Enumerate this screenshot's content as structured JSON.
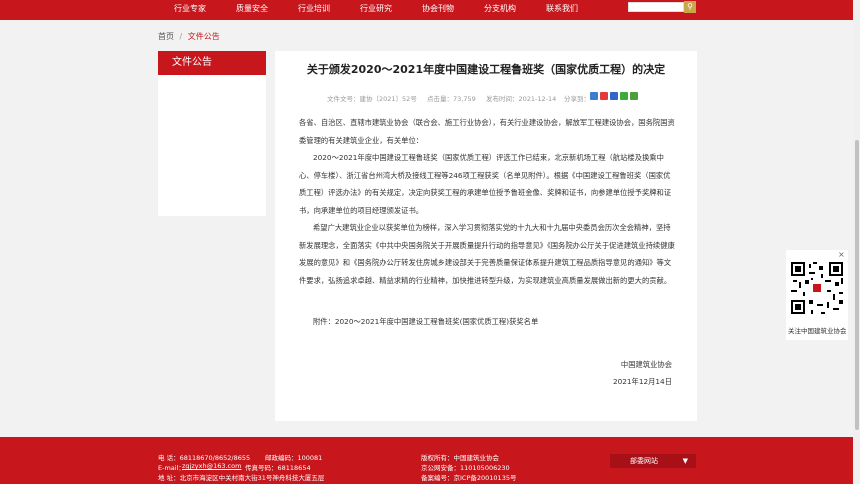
{
  "nav": {
    "items": [
      "行业专家",
      "质量安全",
      "行业培训",
      "行业研究",
      "协会刊物",
      "分支机构",
      "联系我们"
    ],
    "search_icon": "search-icon"
  },
  "breadcrumb": {
    "home": "首页",
    "separator": "/",
    "current": "文件公告"
  },
  "sidebar": {
    "title": "文件公告"
  },
  "article": {
    "title": "关于颁发2020～2021年度中国建设工程鲁班奖（国家优质工程）的决定",
    "meta": {
      "doc_no": "文件文号：建协〔2021〕52号",
      "views": "点击量：73,759",
      "date": "发布时间：2021-12-14",
      "share": "分享到："
    },
    "paragraphs": [
      "各省、自治区、直辖市建筑业协会（联合会、施工行业协会），有关行业建设协会，解放军工程建设协会，国务院国资委管理的有关建筑业企业，有关单位：",
      "2020～2021年度中国建设工程鲁班奖（国家优质工程）评选工作已结束，北京新机场工程（航站楼及换乘中心、停车楼）、浙江省台州湾大桥及接线工程等246项工程获奖（名单见附件）。根据《中国建设工程鲁班奖（国家优质工程）评选办法》的有关规定，决定向获奖工程的承建单位授予鲁班金像、奖牌和证书，向参建单位授予奖牌和证书，向承建单位的项目经理颁发证书。",
      "希望广大建筑业企业以获奖单位为榜样，深入学习贯彻落实党的十九大和十九届中央委员会历次全会精神，坚持新发展理念，全面落实《中共中央国务院关于开展质量提升行动的指导意见》《国务院办公厅关于促进建筑业持续健康发展的意见》和《国务院办公厅转发住房城乡建设部关于完善质量保证体系提升建筑工程品质指导意见的通知》等文件要求，弘扬追求卓越、精益求精的行业精神，加快推进转型升级，为实现建筑业高质量发展做出新的更大的贡献。"
    ],
    "attachment": "附件：2020～2021年度中国建设工程鲁班奖(国家优质工程)获奖名单",
    "signature": "中国建筑业协会",
    "sign_date": "2021年12月14日"
  },
  "qr": {
    "caption": "关注中国建筑业协会",
    "close": "×"
  },
  "footer": {
    "phone": "电  话：68118670/8652/8655",
    "zip": "邮政编码：100081",
    "email_label": "E-mail：",
    "email": "zgjzyxh@163.com",
    "fax": "传真号码：68118654",
    "address": "地  址：北京市海淀区中关村南大街31号神舟科技大厦五层",
    "copyright": "版权所有：中国建筑业协会",
    "police": "京公网安备：110105006230",
    "icp": "备案编号：京ICP备20010135号",
    "select_label": "部委网站"
  },
  "colors": {
    "brand_red": "#c8161d",
    "panel": "#ffffff",
    "bg": "#f2f2f2"
  }
}
